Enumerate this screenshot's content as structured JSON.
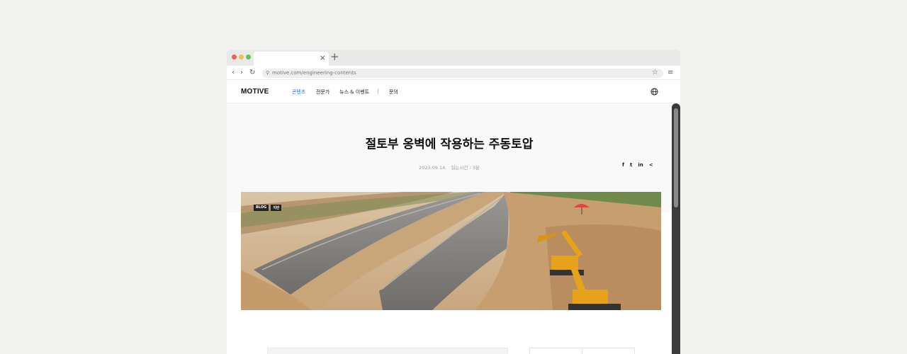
{
  "browser": {
    "url": "motive.com/engineering-contents",
    "tab_close": "×",
    "new_tab": "+",
    "back": "‹",
    "forward": "›",
    "reload": "↻",
    "search_glyph": "⚲",
    "star": "☆",
    "menu": "≡",
    "lights": [
      "#ec5f57",
      "#f3bd4f",
      "#5fc455"
    ]
  },
  "site": {
    "logo": "MOTIVE",
    "nav": [
      {
        "label": "콘텐츠",
        "active": true
      },
      {
        "label": "전문가"
      },
      {
        "label": "뉴스 & 이벤트"
      },
      {
        "label": "|"
      },
      {
        "label": "문의"
      }
    ],
    "accent": "#1a73e8"
  },
  "article": {
    "title": "절토부 옹벽에 작용하는 주동토압",
    "date": "2023.09.14.",
    "read_time": "읽는시간 : 3분",
    "share": [
      "f",
      "t",
      "in",
      "<"
    ],
    "badges": [
      "BLOG",
      "지반"
    ]
  }
}
